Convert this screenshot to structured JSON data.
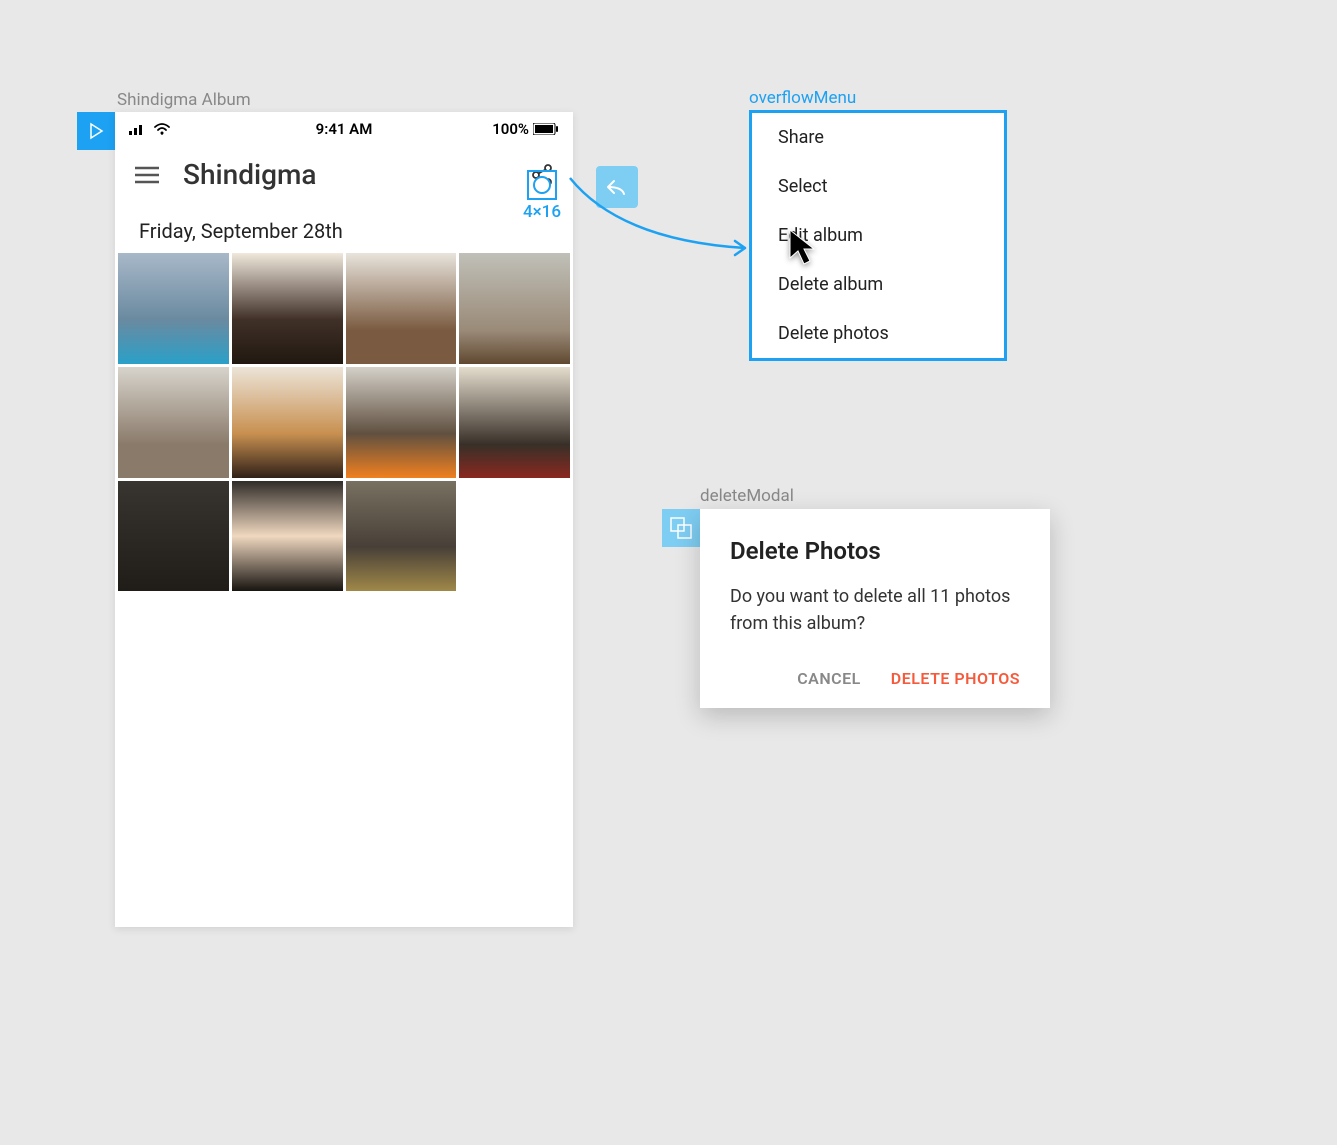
{
  "frames": {
    "album_label": "Shindigma Album",
    "overflow_label": "overflowMenu",
    "modal_label": "deleteModal"
  },
  "phone": {
    "status": {
      "time": "9:41 AM",
      "battery": "100%"
    },
    "appbar": {
      "title": "Shindigma"
    },
    "selection_dim": "4×16",
    "date_header": "Friday, September 28th"
  },
  "overflow": {
    "items": [
      {
        "label": "Share"
      },
      {
        "label": "Select"
      },
      {
        "label": "Edit album"
      },
      {
        "label": "Delete album"
      },
      {
        "label": "Delete photos"
      }
    ]
  },
  "modal": {
    "title": "Delete Photos",
    "body": "Do you want to delete all 11 photos from this album?",
    "cancel": "CANCEL",
    "confirm": "DELETE PHOTOS"
  }
}
